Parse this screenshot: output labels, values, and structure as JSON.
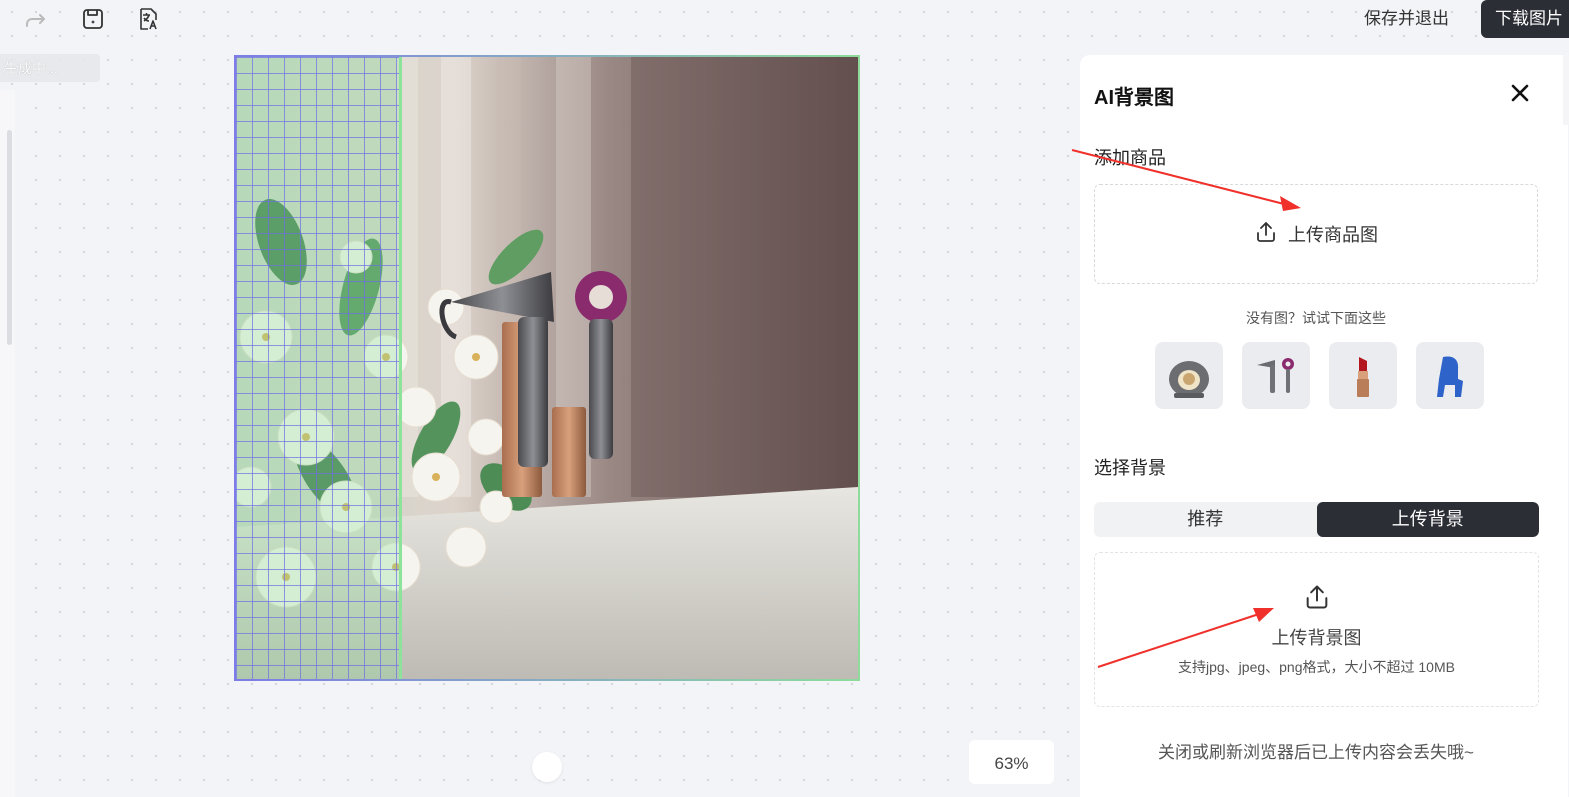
{
  "toolbar": {
    "redo_icon": "redo-icon",
    "save_icon": "save-icon",
    "translate_icon": "translate-icon",
    "save_exit_label": "保存并退出",
    "download_label": "下载图片"
  },
  "canvas": {
    "generating_tag": "生成中...",
    "zoom_value": "63%"
  },
  "panel": {
    "title": "AI背景图",
    "close_icon": "close-icon",
    "add_product_label": "添加商品",
    "upload_product_label": "上传商品图",
    "try_samples_text": "没有图？试试下面这些",
    "samples": [
      "pet-bed",
      "hair-dryer",
      "lipstick",
      "blue-chair"
    ],
    "choose_background_label": "选择背景",
    "tabs": [
      "推荐",
      "上传背景"
    ],
    "active_tab": "上传背景",
    "upload_background_label": "上传背景图",
    "upload_background_hint": "支持jpg、jpeg、png格式，大小不超过 10MB",
    "notice": "关闭或刷新浏览器后已上传内容会丢失哦~"
  },
  "colors": {
    "dark_button": "#2b2e34",
    "annotation_arrow": "#f0302a",
    "grid_line": "#6e6ee6",
    "grid_highlight": "#8ee39b"
  }
}
